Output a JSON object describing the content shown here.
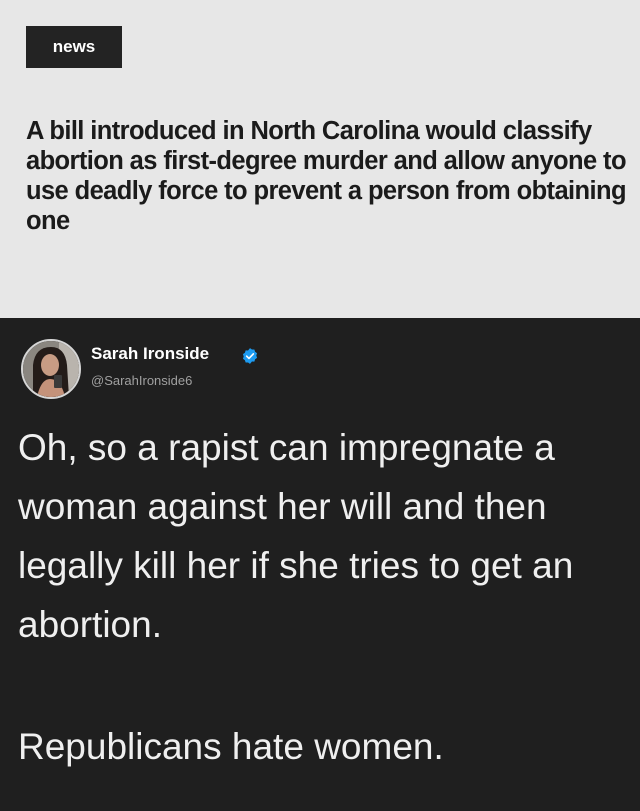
{
  "news": {
    "tag": "news",
    "headline": "A bill introduced in North Carolina would classify abortion as first-degree murder and allow anyone to use deadly force to prevent a person from obtaining one"
  },
  "tweet": {
    "author_name": "Sarah Ironside",
    "handle": "@SarahIronside6",
    "verified_icon": "verified-badge-icon",
    "text_paragraph_1": "Oh, so a rapist can impregnate a woman against her will and then legally kill her if she tries to get an abortion.",
    "text_paragraph_2": "Republicans hate women."
  },
  "colors": {
    "news_background": "#e7e7e7",
    "tag_background": "#232323",
    "tweet_background": "#1f1f1f",
    "verified_blue": "#1d9bf0"
  }
}
